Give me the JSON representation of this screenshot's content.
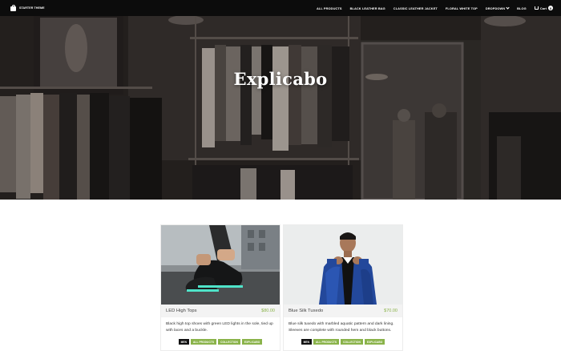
{
  "header": {
    "brand": "STARTER THEME",
    "nav": [
      "ALL PRODUCTS",
      "BLACK LEATHER BAG",
      "CLASSIC LEATHER JACKET",
      "FLORAL WHITE TOP"
    ],
    "dropdown_label": "DROPDOWN",
    "blog_label": "BLOG",
    "cart_label": "Cart",
    "cart_count": "0"
  },
  "hero": {
    "title": "Explicabo"
  },
  "products": [
    {
      "name": "LED High Tops",
      "price": "$80.00",
      "description": "Black high top shoes with green LED lights in the sole, tied up with laces and a buckle.",
      "tags": [
        "MEN",
        "ALL PRODUCTS",
        "COLLECTION",
        "EXPLICABO"
      ],
      "image": "led-high-tops-photo"
    },
    {
      "name": "Blue Silk Tuxedo",
      "price": "$70.00",
      "description": "Blue silk tuxedo with marbled aquatic pattern and dark lining. Sleeves are complete with rounded hem and black buttons.",
      "tags": [
        "MEN",
        "ALL PRODUCTS",
        "COLLECTION",
        "EXPLICABO"
      ],
      "image": "blue-silk-tuxedo-photo"
    }
  ],
  "colors": {
    "accent": "#8ab34a",
    "topbar": "#0c0c0c"
  }
}
